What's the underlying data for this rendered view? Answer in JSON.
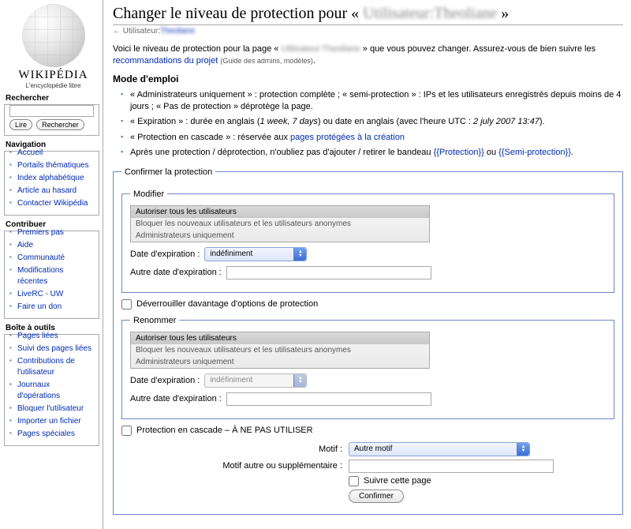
{
  "logo": {
    "name": "WIKIPÉDIA",
    "tagline": "L'encyclopédie libre"
  },
  "search": {
    "heading": "Rechercher",
    "go": "Lire",
    "search": "Rechercher"
  },
  "nav": {
    "heading": "Navigation",
    "items": [
      "Accueil",
      "Portails thématiques",
      "Index alphabétique",
      "Article au hasard",
      "Contacter Wikipédia"
    ]
  },
  "contrib": {
    "heading": "Contribuer",
    "items": [
      "Premiers pas",
      "Aide",
      "Communauté",
      "Modifications récentes",
      "LiveRC - UW",
      "Faire un don"
    ]
  },
  "toolbox": {
    "heading": "Boîte à outils",
    "items": [
      "Pages liées",
      "Suivi des pages liées",
      "Contributions de l'utilisateur",
      "Journaux d'opérations",
      "Bloquer l'utilisateur",
      "Importer un fichier",
      "Pages spéciales"
    ]
  },
  "title_prefix": "Changer le niveau de protection pour « ",
  "title_user": "Utilisateur:Theoliane",
  "title_suffix": " »",
  "subtitle_arrow": "← ",
  "subtitle_label": "Utilisateur:",
  "subtitle_name": "Theoliane",
  "intro": {
    "t1": "Voici le niveau de protection pour la page « ",
    "t1_user": "Utilisateur:Theoliane",
    "t2": " » que vous pouvez changer. Assurez-vous de bien suivre les ",
    "link1": "recommandations du projet",
    "t3": " ",
    "small": "(Guide des admins, modèles)",
    "t4": "."
  },
  "mode_heading": "Mode d'emploi",
  "instr": {
    "i1": "« Administrateurs uniquement » : protection complète ; « semi-protection » : IPs et les utilisateurs enregistrés depuis moins de 4 jours ; « Pas de protection » déprotège la page.",
    "i2a": "« Expiration » : durée en anglais (",
    "i2b": "1 week, 7 days",
    "i2c": ") ou date en anglais (avec l'heure UTC : ",
    "i2d": "2 july 2007 13:47",
    "i2e": ").",
    "i3a": "« Protection en cascade » : réservée aux ",
    "i3link": "pages protégées à la création",
    "i4a": "Après une protection / déprotection, n'oubliez pas d'ajouter / retirer le bandeau ",
    "i4l1": "{{Protection}}",
    "i4b": " ou ",
    "i4l2": "{{Semi-protection}}",
    "i4c": "."
  },
  "outer_legend": "Confirmer la protection",
  "modify": {
    "legend": "Modifier",
    "opt1": "Autoriser tous les utilisateurs",
    "opt2": "Bloquer les nouveaux utilisateurs et les utilisateurs anonymes",
    "opt3": "Administrateurs uniquement",
    "exp_label": "Date d'expiration :",
    "exp_value": "indéfiniment",
    "other_label": "Autre date d'expiration :"
  },
  "unlock": "Déverrouiller davantage d'options de protection",
  "rename": {
    "legend": "Renommer",
    "opt1": "Autoriser tous les utilisateurs",
    "opt2": "Bloquer les nouveaux utilisateurs et les utilisateurs anonymes",
    "opt3": "Administrateurs uniquement",
    "exp_label": "Date d'expiration :",
    "exp_value": "indéfiniment",
    "other_label": "Autre date d'expiration :"
  },
  "cascade": "Protection en cascade – À NE PAS UTILISER",
  "reason_label": "Motif :",
  "reason_value": "Autre motif",
  "other_reason_label": "Motif autre ou supplémentaire :",
  "watch": "Suivre cette page",
  "confirm": "Confirmer"
}
